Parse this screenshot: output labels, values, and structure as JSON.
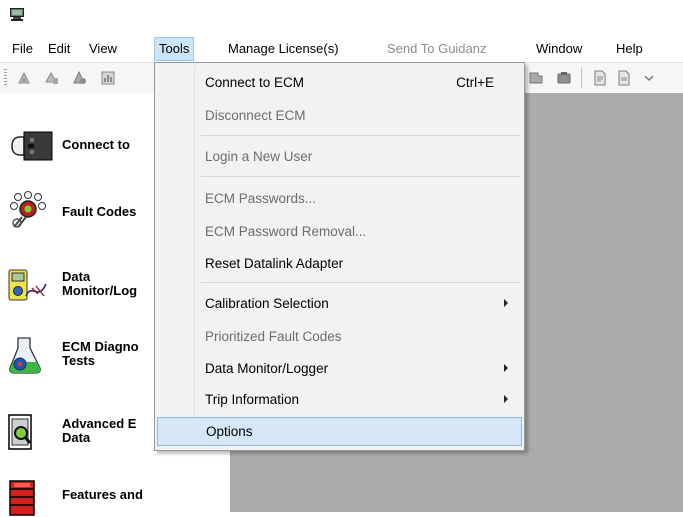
{
  "menubar": {
    "items": [
      {
        "label": "File"
      },
      {
        "label": "Edit"
      },
      {
        "label": "View"
      },
      {
        "label": "Tools"
      },
      {
        "label": "Manage License(s)"
      },
      {
        "label": "Send To Guidanz"
      },
      {
        "label": "Window"
      },
      {
        "label": "Help"
      }
    ]
  },
  "sidebar": {
    "items": [
      {
        "label": "Connect to",
        "icon": "connector-plug-icon"
      },
      {
        "label": "Fault Codes",
        "icon": "fault-codes-gears-icon"
      },
      {
        "label": "Data\nMonitor/Log",
        "icon": "data-monitor-icon"
      },
      {
        "label": "ECM Diagno\nTests",
        "icon": "ecm-diagnostic-flask-icon"
      },
      {
        "label": "Advanced E\nData",
        "icon": "advanced-data-magnifier-icon"
      },
      {
        "label": "Features and",
        "icon": "features-red-stack-icon"
      }
    ]
  },
  "tools_menu": {
    "items": [
      {
        "label": "Connect to ECM",
        "shortcut": "Ctrl+E",
        "enabled": true
      },
      {
        "label": "Disconnect ECM",
        "enabled": false
      },
      {
        "label": "Login a New User",
        "enabled": false
      },
      {
        "label": "ECM Passwords...",
        "enabled": false
      },
      {
        "label": "ECM Password Removal...",
        "enabled": false
      },
      {
        "label": "Reset Datalink Adapter",
        "enabled": true
      },
      {
        "label": "Calibration Selection",
        "enabled": true,
        "submenu": true
      },
      {
        "label": "Prioritized Fault Codes",
        "enabled": false
      },
      {
        "label": "Data Monitor/Logger",
        "enabled": true,
        "submenu": true
      },
      {
        "label": "Trip Information",
        "enabled": true,
        "submenu": true
      },
      {
        "label": "Options",
        "enabled": true,
        "highlighted": true
      }
    ]
  },
  "colors": {
    "menu_active": "#cce4f7",
    "item_hover": "#d7e6f6",
    "workspace": "#ababab",
    "disabled_text": "#6d6d6d"
  }
}
